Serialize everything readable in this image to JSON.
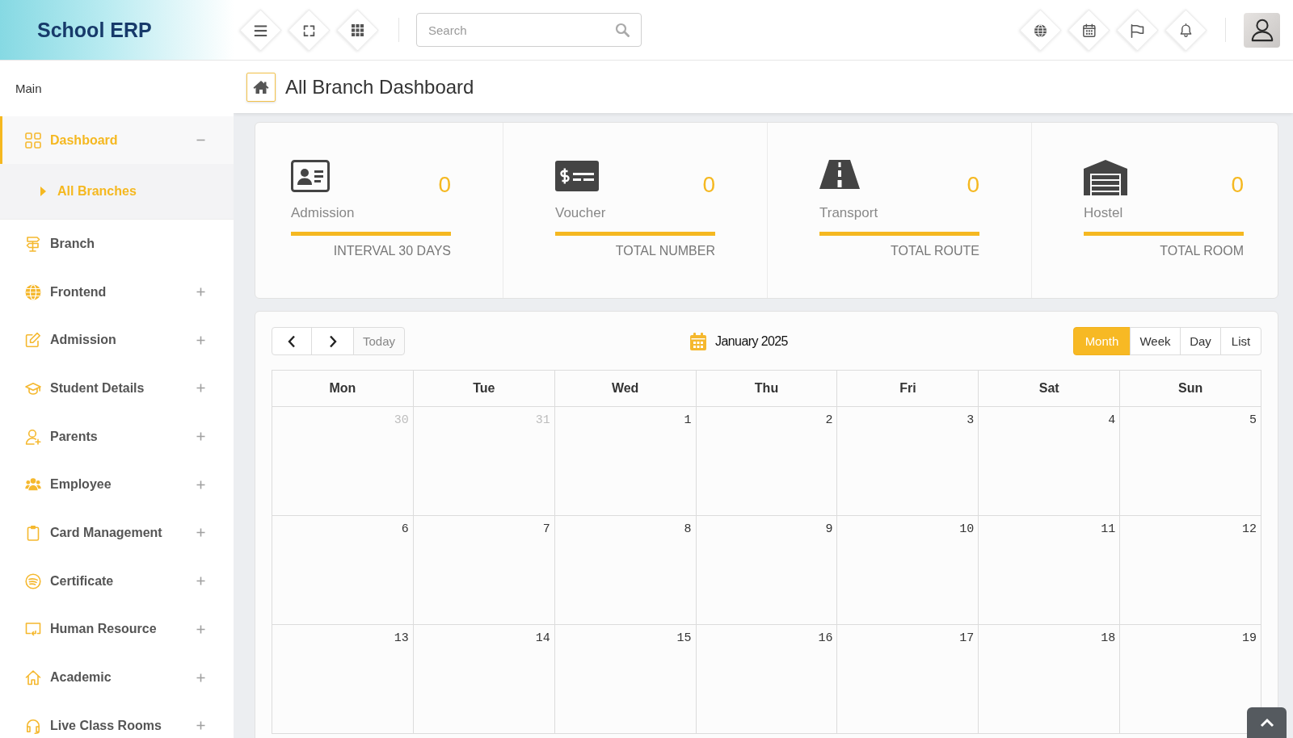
{
  "header": {
    "logo": "School ERP",
    "search": {
      "placeholder": "Search"
    }
  },
  "sidebar": {
    "section": "Main",
    "items": [
      {
        "kind": "group",
        "label": "Dashboard",
        "selected": true,
        "expanded": true,
        "children": [
          {
            "label": "All Branches",
            "selected": true
          }
        ]
      },
      {
        "kind": "link",
        "label": "Branch",
        "selected": false
      },
      {
        "kind": "group",
        "label": "Frontend",
        "selected": false,
        "expanded": false
      },
      {
        "kind": "group",
        "label": "Admission",
        "selected": false,
        "expanded": false
      },
      {
        "kind": "group",
        "label": "Student Details",
        "selected": false,
        "expanded": false
      },
      {
        "kind": "group",
        "label": "Parents",
        "selected": false,
        "expanded": false
      },
      {
        "kind": "group",
        "label": "Employee",
        "selected": false,
        "expanded": false
      },
      {
        "kind": "group",
        "label": "Card Management",
        "selected": false,
        "expanded": false
      },
      {
        "kind": "group",
        "label": "Certificate",
        "selected": false,
        "expanded": false
      },
      {
        "kind": "group",
        "label": "Human Resource",
        "selected": false,
        "expanded": false
      },
      {
        "kind": "group",
        "label": "Academic",
        "selected": false,
        "expanded": false
      },
      {
        "kind": "group",
        "label": "Live Class Rooms",
        "selected": false,
        "expanded": false
      }
    ]
  },
  "page_header": {
    "title": "All Branch Dashboard"
  },
  "stats": [
    {
      "label": "Admission",
      "value": "0",
      "caption": "INTERVAL 30 DAYS"
    },
    {
      "label": "Voucher",
      "value": "0",
      "caption": "TOTAL NUMBER"
    },
    {
      "label": "Transport",
      "value": "0",
      "caption": "TOTAL ROUTE"
    },
    {
      "label": "Hostel",
      "value": "0",
      "caption": "TOTAL ROOM"
    }
  ],
  "calendar": {
    "title": "January 2025",
    "today_button": {
      "label": "Today",
      "disabled": true
    },
    "views": [
      {
        "label": "Month",
        "selected": true
      },
      {
        "label": "Week",
        "selected": false
      },
      {
        "label": "Day",
        "selected": false
      },
      {
        "label": "List",
        "selected": false
      }
    ],
    "weekdays": [
      "Mon",
      "Tue",
      "Wed",
      "Thu",
      "Fri",
      "Sat",
      "Sun"
    ],
    "weeks": [
      [
        {
          "day": "30",
          "other_month": true
        },
        {
          "day": "31",
          "other_month": true
        },
        {
          "day": "1",
          "other_month": false
        },
        {
          "day": "2",
          "other_month": false
        },
        {
          "day": "3",
          "other_month": false
        },
        {
          "day": "4",
          "other_month": false
        },
        {
          "day": "5",
          "other_month": false
        }
      ],
      [
        {
          "day": "6",
          "other_month": false
        },
        {
          "day": "7",
          "other_month": false
        },
        {
          "day": "8",
          "other_month": false
        },
        {
          "day": "9",
          "other_month": false
        },
        {
          "day": "10",
          "other_month": false
        },
        {
          "day": "11",
          "other_month": false
        },
        {
          "day": "12",
          "other_month": false
        }
      ],
      [
        {
          "day": "13",
          "other_month": false
        },
        {
          "day": "14",
          "other_month": false
        },
        {
          "day": "15",
          "other_month": false
        },
        {
          "day": "16",
          "other_month": false
        },
        {
          "day": "17",
          "other_month": false
        },
        {
          "day": "18",
          "other_month": false
        },
        {
          "day": "19",
          "other_month": false
        }
      ]
    ]
  }
}
